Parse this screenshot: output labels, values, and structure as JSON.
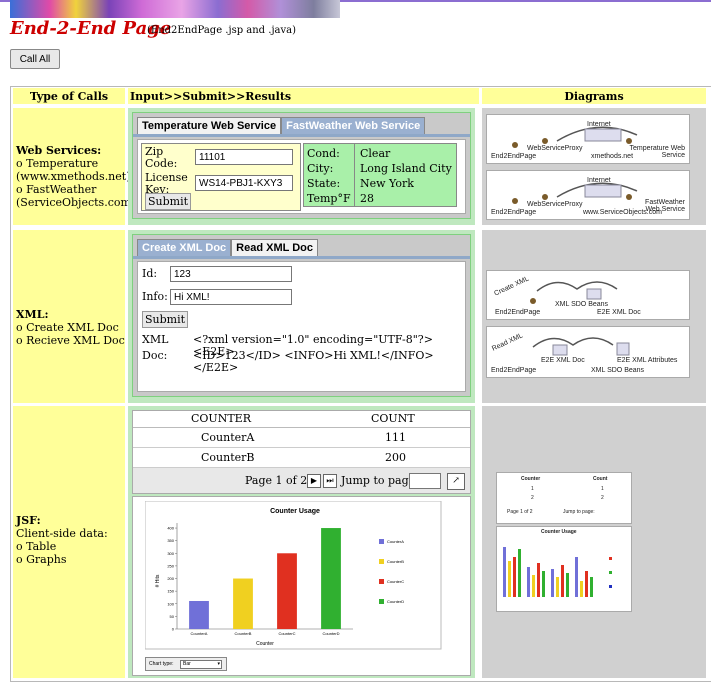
{
  "header": {
    "title": "End-2-End Page",
    "subtitle": "(End2EndPage .jsp and .java)",
    "call_all_label": "Call All"
  },
  "table_headers": {
    "type": "Type of Calls",
    "input": "Input>>Submit>>Results",
    "diagrams": "Diagrams"
  },
  "web_services": {
    "label_title": "Web Services:",
    "label_lines": [
      "o Temperature",
      "(www.xmethods.net)",
      "o FastWeather",
      "(ServiceObjects.com)"
    ],
    "tab_active": "Temperature Web Service",
    "tab_inactive": "FastWeather Web Service",
    "zip_label": "Zip Code:",
    "zip_value": "11101",
    "license_label": "License Key:",
    "license_value": "WS14-PBJ1-KXY3",
    "submit_label": "Submit",
    "results": [
      {
        "key": "Cond:",
        "value": "Clear"
      },
      {
        "key": "City:",
        "value": "Long Island City"
      },
      {
        "key": "State:",
        "value": "New York"
      },
      {
        "key": "Temp°F",
        "value": "28"
      }
    ],
    "diagram1": {
      "internet": "Internet",
      "proxy": "WebServiceProxy",
      "page": "End2EndPage",
      "svc": "Temperature Web Service",
      "host": "xmethods.net"
    },
    "diagram2": {
      "internet": "Internet",
      "proxy": "WebServiceProxy",
      "page": "End2EndPage",
      "svc": "FastWeather Web Service",
      "host": "www.ServiceObjects.com"
    }
  },
  "xml": {
    "label_title": "XML:",
    "label_lines": [
      "o Create XML Doc",
      "o Recieve XML Doc"
    ],
    "tab_inactive": "Create XML Doc",
    "tab_active": "Read XML Doc",
    "id_label": "Id:",
    "id_value": "123",
    "info_label": "Info:",
    "info_value": "Hi XML!",
    "submit_label": "Submit",
    "doc_label_1": "XML",
    "doc_label_2": "Doc:",
    "doc_line_1": "<?xml version=\"1.0\" encoding=\"UTF-8\"?> <E2E>",
    "doc_line_2": "<ID>123</ID> <INFO>Hi XML!</INFO> </E2E>",
    "diagram1": {
      "action": "Create XML",
      "beans": "XML SDO Beans",
      "page": "End2EndPage",
      "doc": "E2E XML Doc"
    },
    "diagram2": {
      "action": "Read XML",
      "doc": "E2E XML Doc",
      "attrs": "E2E XML Attributes",
      "page": "End2EndPage",
      "beans": "XML SDO Beans"
    }
  },
  "jsf": {
    "label_title": "JSF:",
    "label_lines": [
      "Client-side data:",
      "o Table",
      "o Graphs"
    ],
    "table_headers": [
      "COUNTER",
      "COUNT"
    ],
    "rows": [
      {
        "counter": "CounterA",
        "count": "111"
      },
      {
        "counter": "CounterB",
        "count": "200"
      }
    ],
    "pager_text": "Page 1 of 2",
    "jump_label": "Jump to page:",
    "chart_type_label": "Chart type:",
    "chart_type_value": "Bar",
    "mini_headers": [
      "Counter",
      "Count"
    ],
    "mini_rows": [
      [
        "1",
        "1"
      ],
      [
        "2",
        "2"
      ]
    ],
    "mini_pager": "Page 1 of 2",
    "mini_jump": "Jump to page:",
    "mini_chart_title": "Counter Usage"
  },
  "chart_data": {
    "type": "bar",
    "title": "Counter Usage",
    "xlabel": "Counter",
    "ylabel": "# Hits",
    "categories": [
      "CounterA",
      "CounterB",
      "CounterC",
      "CounterD"
    ],
    "values": [
      111,
      200,
      300,
      400
    ],
    "colors": [
      "#7070d8",
      "#f0d020",
      "#e03020",
      "#30b030"
    ],
    "legend": [
      "CounterA",
      "CounterB",
      "CounterC",
      "CounterD"
    ],
    "yticks": [
      "0",
      "50",
      "100",
      "150",
      "200",
      "250",
      "300",
      "350",
      "400"
    ],
    "ylim": [
      0,
      420
    ]
  }
}
